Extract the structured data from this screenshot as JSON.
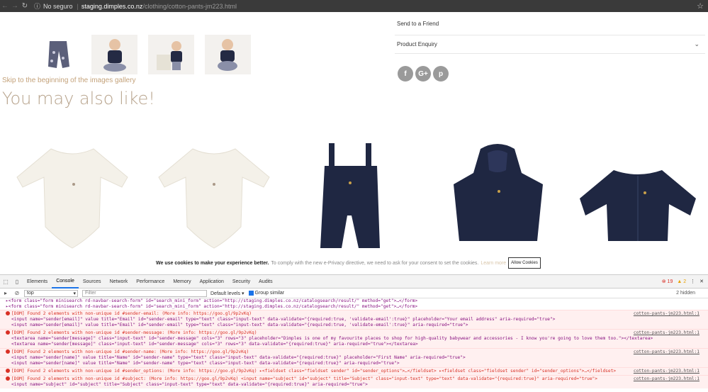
{
  "browser": {
    "security": "No seguro",
    "host": "staging.dimples.co.nz",
    "path": "/clothing/cotton-pants-jm223.html"
  },
  "page": {
    "skip_link": "Skip to the beginning of the images gallery",
    "also_like": "You may also like!",
    "accordion": [
      "Send to a Friend",
      "Product Enquiry"
    ],
    "social": [
      "f",
      "G+",
      "p"
    ]
  },
  "cookie": {
    "bold": "We use cookies to make your experience better.",
    "text": "To comply with the new e-Privacy directive, we need to ask for your consent to set the cookies.",
    "learn": "Learn more",
    "allow": "Allow Cookies"
  },
  "devtools": {
    "tabs": [
      "Elements",
      "Console",
      "Sources",
      "Network",
      "Performance",
      "Memory",
      "Application",
      "Security",
      "Audits"
    ],
    "active_tab": "Console",
    "errors": "19",
    "warnings": "2",
    "context": "top",
    "filter_placeholder": "Filter",
    "levels": "Default levels",
    "group_similar": "Group similar",
    "hidden": "2 hidden",
    "plain_lines": [
      "▸<form class=\"form minisearch rd-navbar-search-form\" id=\"search_mini_form\" action=\"http://staging.dimples.co.nz/catalogsearch/result/\" method=\"get\">…</form>",
      "▸<form class=\"form minisearch rd-navbar-search-form\" id=\"search_mini_form\" action=\"http://staging.dimples.co.nz/catalogsearch/result/\" method=\"get\">…</form>"
    ],
    "errors_list": [
      {
        "msg": "[DOM] Found 2 elements with non-unique id #sender-email: (More info: https://goo.gl/9p2vKq)",
        "src": "cotton-pants-jm223.html:1",
        "subs": [
          "<input name=\"sender[email]\" value title=\"Email\" id=\"sender-email\" type=\"text\" class=\"input-text\" data-validate=\"{required:true, 'validate-email':true}\" placeholder=\"Your email address\" aria-required=\"true\">",
          "<input name=\"sender[email]\" value title=\"Email\" id=\"sender-email\" type=\"text\" class=\"input-text\" data-validate=\"{required:true, 'validate-email':true}\" aria-required=\"true\">"
        ]
      },
      {
        "msg": "[DOM] Found 2 elements with non-unique id #sender-message: (More info: https://goo.gl/9p2vKq)",
        "src": "cotton-pants-jm223.html:1",
        "subs": [
          "<textarea name=\"sender[message]\" class=\"input-text\" id=\"sender-message\" cols=\"3\" rows=\"3\" placeholder=\"Dimples is one of my favourite places to shop for high-quality babywear and accessories - I know you're going to love them too.\"></textarea>",
          "<textarea name=\"sender[message]\" class=\"input-text\" id=\"sender-message\" cols=\"3\" rows=\"3\" data-validate=\"{required:true}\" aria-required=\"true\"></textarea>"
        ]
      },
      {
        "msg": "[DOM] Found 2 elements with non-unique id #sender-name: (More info: https://goo.gl/9p2vKq)",
        "src": "cotton-pants-jm223.html:1",
        "subs": [
          "<input name=\"sender[name]\" value title=\"Name\" id=\"sender-name\" type=\"text\" class=\"input-text\" data-validate=\"{required:true}\" placeholder=\"First Name\" aria-required=\"true\">",
          "<input name=\"sender[name]\" value title=\"Name\" id=\"sender-name\" type=\"text\" class=\"input-text\" data-validate=\"{required:true}\" aria-required=\"true\">"
        ]
      },
      {
        "msg": "[DOM] Found 2 elements with non-unique id #sender_options: (More info: https://goo.gl/9p2vKq) ▸<fieldset class=\"fieldset sender\" id=\"sender_options\">…</fieldset>  ▸<fieldset class=\"fieldset sender\" id=\"sender_options\">…</fieldset>",
        "src": "cotton-pants-jm223.html:1",
        "subs": []
      },
      {
        "msg": "[DOM] Found 2 elements with non-unique id #subject: (More info: https://goo.gl/9p2vKq)   <input name=\"subject\" id=\"subject\" title=\"Subject\" class=\"input-text\" type=\"text\" data-validate=\"{required:true}\" aria-required=\"true\">",
        "src": "cotton-pants-jm223.html:1",
        "subs": [
          "<input name=\"subject\" id=\"subject\" title=\"Subject\" class=\"input-text\" type=\"text\" data-validate=\"{required:true}\" aria-required=\"true\">"
        ]
      }
    ]
  }
}
